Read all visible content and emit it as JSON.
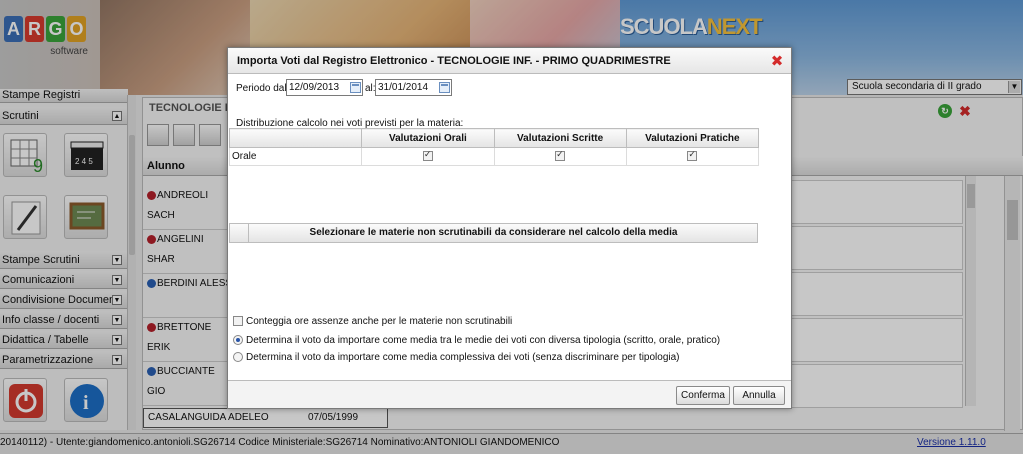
{
  "header": {
    "logo_letters": [
      "A",
      "R",
      "G",
      "O"
    ],
    "logo_colors": [
      "#3b6fb6",
      "#d83a2e",
      "#3aa43a",
      "#e2a325"
    ],
    "logo_sub": "software",
    "brand_main": "SCUOLA",
    "brand_accent": "NEXT",
    "school_select": "Scuola secondaria di II grado"
  },
  "sidebar": {
    "sections": [
      {
        "label": "Stampe Registri"
      },
      {
        "label": "Scrutini"
      },
      {
        "label": "Stampe Scrutini"
      },
      {
        "label": "Comunicazioni"
      },
      {
        "label": "Condivisione Documenti"
      },
      {
        "label": "Info classe / docenti"
      },
      {
        "label": "Didattica / Tabelle"
      },
      {
        "label": "Parametrizzazione"
      }
    ],
    "tile_icons": [
      "grid-nine-icon",
      "clapperboard-icon",
      "pencil-icon",
      "blackboard-icon",
      "power-icon",
      "info-icon"
    ]
  },
  "main": {
    "title": "TECNOLOGIE IN",
    "column_header": "Alunno",
    "students": [
      {
        "name": "ANDREOLI SACH",
        "kind": "female"
      },
      {
        "name": "ANGELINI SHAR",
        "kind": "female"
      },
      {
        "name": "BERDINI ALESS",
        "kind": "male"
      },
      {
        "name": "BRETTONE ERIK",
        "kind": "female"
      },
      {
        "name": "BUCCIANTE GIO",
        "kind": "male"
      }
    ],
    "bottom_row": {
      "name": "CASALANGUIDA ADELEO",
      "date": "07/05/1999"
    }
  },
  "dialog": {
    "title": "Importa Voti dal Registro Elettronico - TECNOLOGIE INF. - PRIMO QUADRIMESTRE",
    "period_from_label": "Periodo dal:",
    "period_from": "12/09/2013",
    "period_to_label": "al:",
    "period_to": "31/01/2014",
    "distribution_label": "Distribuzione calcolo nei voti previsti per la materia:",
    "table_headers": [
      "",
      "Valutazioni Orali",
      "Valutazioni Scritte",
      "Valutazioni Pratiche"
    ],
    "table_rows": [
      {
        "label": "Orale",
        "orali": true,
        "scritte": true,
        "pratiche": true
      }
    ],
    "subjects_header": "Selezionare le materie non scrutinabili da considerare nel calcolo della media",
    "option_absences": "Conteggia ore assenze anche per le materie non scrutinabili",
    "option_absences_checked": false,
    "option_mean_types": "Determina il voto da importare come media tra le medie dei voti con diversa tipologia (scritto, orale, pratico)",
    "option_mean_overall": "Determina il voto da importare come media complessiva dei voti (senza discriminare per tipologia)",
    "selected_option": "mean_types",
    "confirm_label": "Conferma",
    "cancel_label": "Annulla"
  },
  "statusbar": {
    "text": "20140112) - Utente:giandomenico.antonioli.SG26714 Codice Ministeriale:SG26714 Nominativo:ANTONIOLI GIANDOMENICO",
    "version": "Versione 1.11.0"
  }
}
